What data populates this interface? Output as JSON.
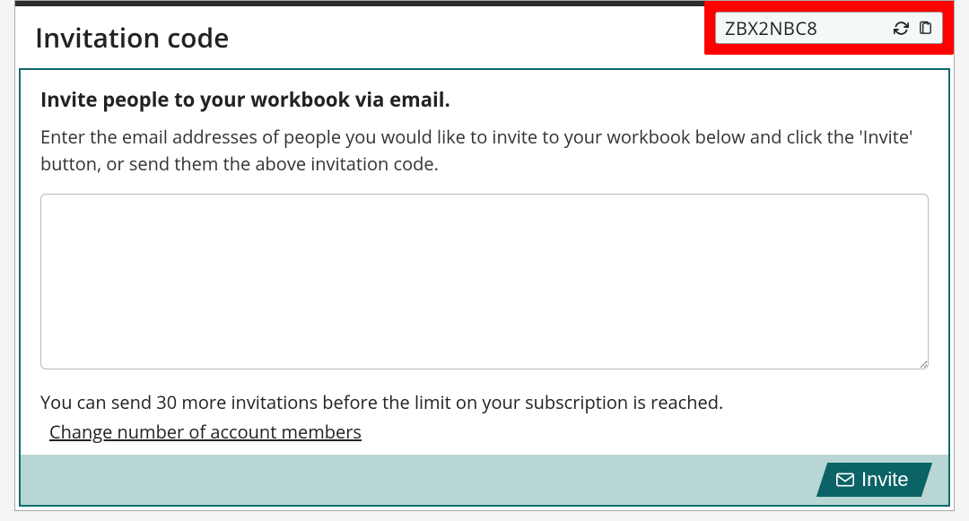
{
  "header": {
    "title": "Invitation code",
    "code_value": "ZBX2NBC8"
  },
  "main": {
    "subheading": "Invite people to your workbook via email.",
    "description": "Enter the email addresses of people you would like to invite to your workbook below and click the 'Invite' button, or send them the above invitation code.",
    "email_value": "",
    "limit_text": "You can send 30 more invitations before the limit on your subscription is reached.",
    "change_link": "Change number of account members"
  },
  "footer": {
    "invite_label": "Invite"
  }
}
